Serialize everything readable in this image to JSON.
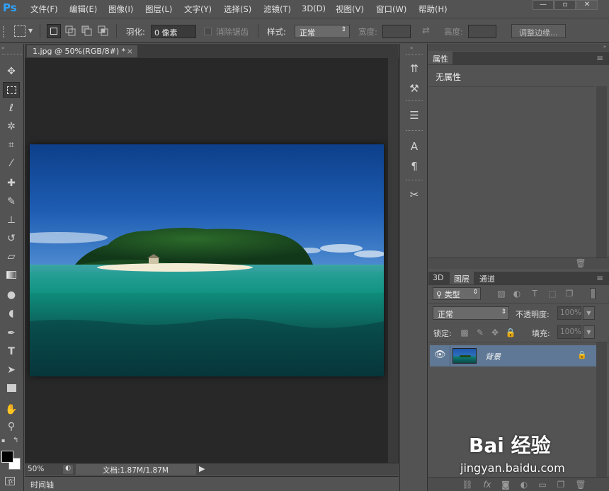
{
  "app": {
    "logo": "Ps",
    "colors": {
      "ui_gray": "#535353",
      "canvas_dark": "#282828",
      "accent_blue": "#2fa3ff",
      "layer_selected": "#5f7896"
    }
  },
  "menu": {
    "items": [
      "文件(F)",
      "编辑(E)",
      "图像(I)",
      "图层(L)",
      "文字(Y)",
      "选择(S)",
      "滤镜(T)",
      "3D(D)",
      "视图(V)",
      "窗口(W)",
      "帮助(H)"
    ],
    "window_controls": [
      "—",
      "▫",
      "✕"
    ]
  },
  "options": {
    "feather_label": "羽化:",
    "feather_value": "0 像素",
    "antialias_label": "消除锯齿",
    "style_label": "样式:",
    "style_value": "正常",
    "width_label": "宽度:",
    "height_label": "高度:",
    "refine_edge_label": "调整边缘..."
  },
  "document": {
    "tab_title": "1.jpg @ 50%(RGB/8#) *",
    "zoom": "50%",
    "doc_info": "文档:1.87M/1.87M",
    "timeline_label": "时间轴"
  },
  "tools": [
    "move-icon",
    "marquee-icon",
    "lasso-icon",
    "magic-wand-icon",
    "crop-icon",
    "eyedropper-icon",
    "healing-brush-icon",
    "brush-icon",
    "clone-stamp-icon",
    "history-brush-icon",
    "eraser-icon",
    "gradient-icon",
    "blur-icon",
    "dodge-icon",
    "pen-icon",
    "type-icon",
    "path-selection-icon",
    "rectangle-icon",
    "hand-icon",
    "zoom-icon"
  ],
  "properties_panel": {
    "tab_label": "属性",
    "content": "无属性"
  },
  "layers_panel": {
    "tabs": [
      "3D",
      "图层",
      "通道"
    ],
    "filter_label": "类型",
    "blend_mode": "正常",
    "opacity_label": "不透明度:",
    "opacity_value": "100%",
    "lock_label": "锁定:",
    "fill_label": "填充:",
    "fill_value": "100%",
    "layers": [
      {
        "name": "背景",
        "locked": true,
        "visible": true
      }
    ]
  },
  "watermark": {
    "brand": "Bai 经验",
    "url": "jingyan.baidu.com"
  }
}
